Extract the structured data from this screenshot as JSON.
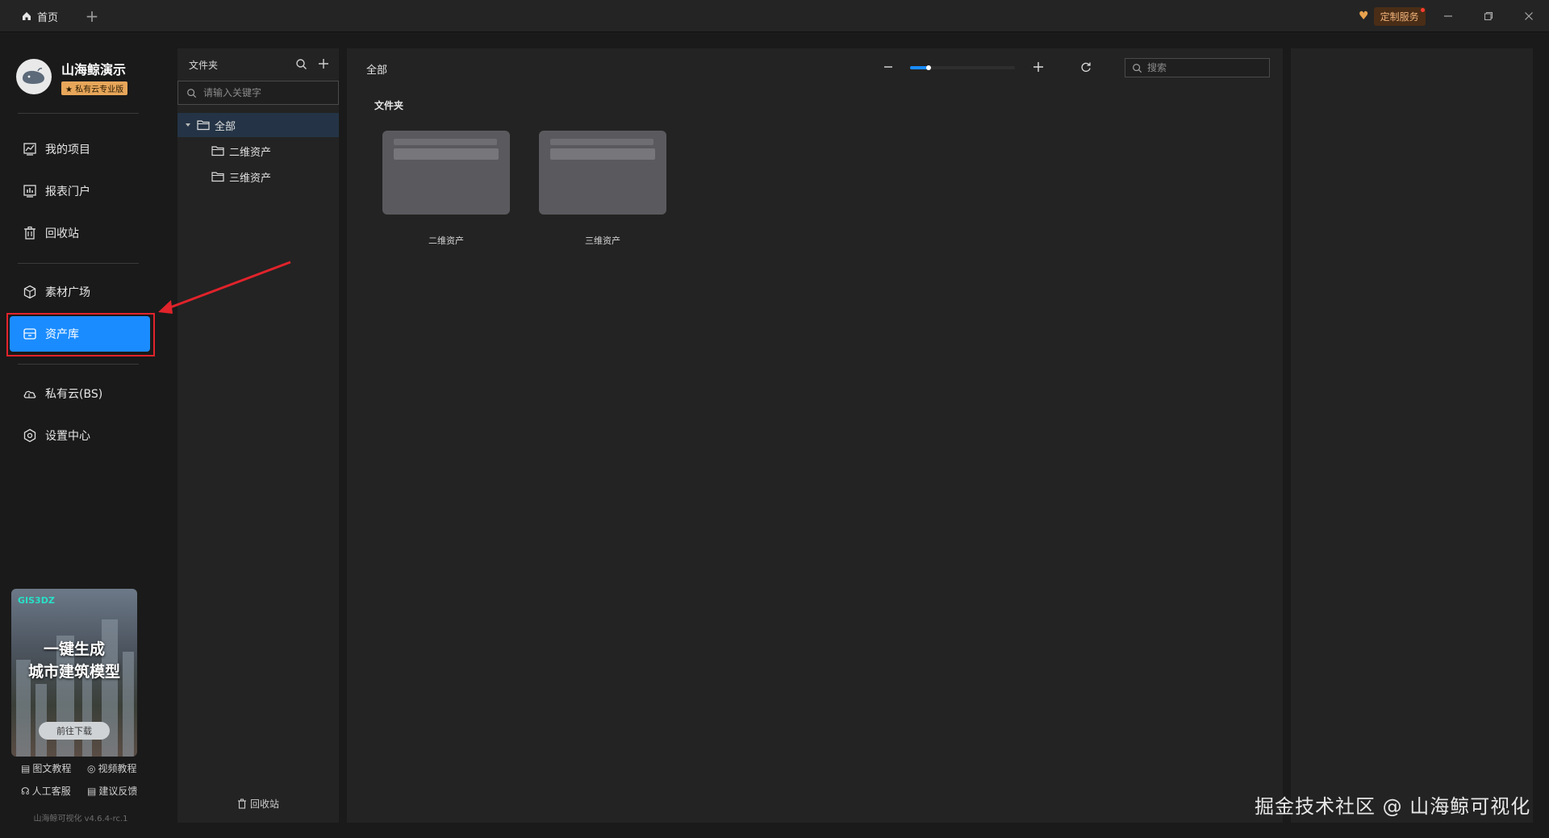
{
  "titlebar": {
    "home_tab_label": "首页",
    "custom_service_label": "定制服务"
  },
  "brand": {
    "name": "山海鲸演示",
    "edition": "私有云专业版"
  },
  "nav": {
    "items": [
      {
        "label": "我的项目",
        "icon": "chart-line-icon"
      },
      {
        "label": "报表门户",
        "icon": "bar-chart-icon"
      },
      {
        "label": "回收站",
        "icon": "trash-icon"
      },
      {
        "label": "素材广场",
        "icon": "cube-icon"
      },
      {
        "label": "资产库",
        "icon": "asset-box-icon",
        "active": true
      },
      {
        "label": "私有云(BS)",
        "icon": "cloud-icon"
      },
      {
        "label": "设置中心",
        "icon": "gear-icon"
      }
    ]
  },
  "promo": {
    "brand_tag": "GIS3DZ",
    "headline_1": "一键生成",
    "headline_2": "城市建筑模型",
    "download_label": "前往下载"
  },
  "help": {
    "text_tutorial": "图文教程",
    "video_tutorial": "视频教程",
    "human_support": "人工客服",
    "feedback": "建议反馈"
  },
  "version": "山海鲸可视化 v4.6.4-rc.1",
  "folder_panel": {
    "title": "文件夹",
    "search_placeholder": "请输入关键字",
    "tree": {
      "root": "全部",
      "children": [
        "二维资产",
        "三维资产"
      ]
    },
    "recycle_label": "回收站"
  },
  "main": {
    "breadcrumb": "全部",
    "zoom_level": 0.18,
    "search_placeholder": "搜索",
    "section_label": "文件夹",
    "folders": [
      "二维资产",
      "三维资产"
    ]
  },
  "watermark": "掘金技术社区 @ 山海鲸可视化",
  "colors": {
    "accent": "#1a8cff",
    "highlight": "#e1232b",
    "badge": "#e7a65a"
  }
}
